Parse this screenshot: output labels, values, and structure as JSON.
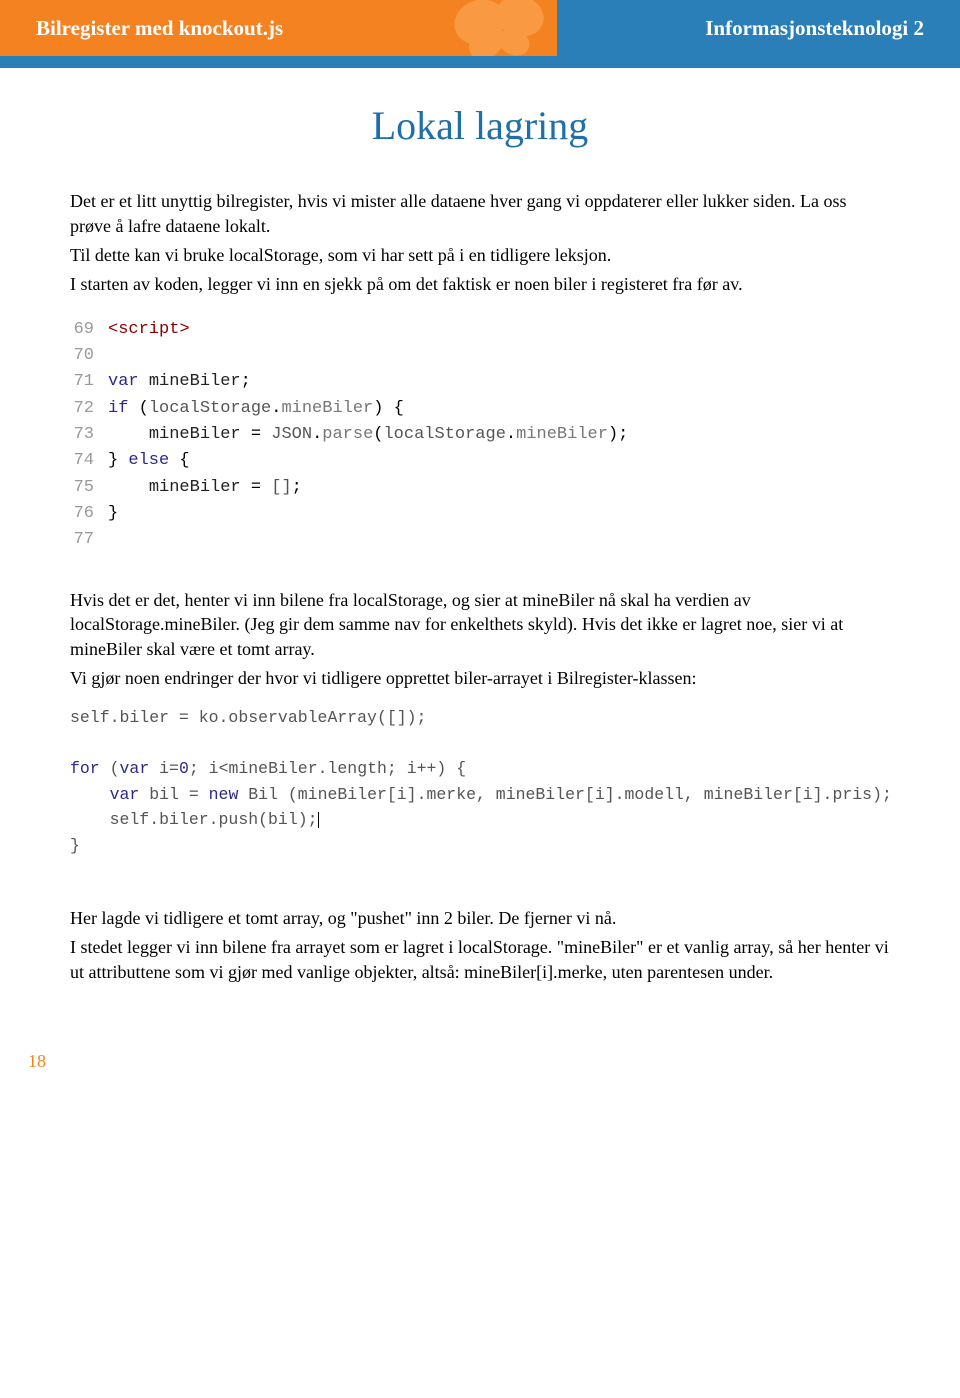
{
  "header": {
    "left": "Bilregister med knockout.js",
    "right": "Informasjonsteknologi 2"
  },
  "title": "Lokal lagring",
  "para1": "Det er et litt unyttig bilregister, hvis vi mister alle dataene hver gang vi oppdaterer eller lukker siden. La oss prøve å lafre dataene lokalt.",
  "para2": "Til dette kan vi bruke localStorage, som vi har sett på i en tidligere leksjon.",
  "para3": "I starten av koden, legger vi inn en sjekk på om det faktisk er noen biler i registeret fra før av.",
  "code1": {
    "lines": [
      {
        "n": "69",
        "html": "<span class='tok-tag'>&lt;script&gt;</span>"
      },
      {
        "n": "70",
        "html": ""
      },
      {
        "n": "71",
        "html": "<span class='tok-kw'>var</span> <span class='tok-var'>mineBiler</span>;"
      },
      {
        "n": "72",
        "html": "<span class='tok-kw'>if</span> (<span class='tok-obj'>localStorage</span>.<span class='tok-prop'>mineBiler</span>) {"
      },
      {
        "n": "73",
        "html": "    <span class='tok-var'>mineBiler</span> = <span class='tok-obj'>JSON</span>.<span class='tok-fn'>parse</span>(<span class='tok-obj'>localStorage</span>.<span class='tok-prop'>mineBiler</span>);"
      },
      {
        "n": "74",
        "html": "} <span class='tok-kw'>else</span> {"
      },
      {
        "n": "75",
        "html": "    <span class='tok-var'>mineBiler</span> = <span class='tok-bracket'>[]</span>;"
      },
      {
        "n": "76",
        "html": "}"
      },
      {
        "n": "77",
        "html": ""
      }
    ]
  },
  "para4": "Hvis det er det, henter vi inn bilene fra localStorage, og sier at mineBiler nå skal ha verdien av localStorage.mineBiler. (Jeg gir dem samme nav for enkelthets skyld). Hvis det ikke er lagret noe, sier vi at mineBiler skal være et tomt array.",
  "para5": "Vi gjør noen endringer der hvor vi tidligere opprettet biler-arrayet i Bilregister-klassen:",
  "code2": {
    "lines": [
      "self.biler = ko.observableArray([]);",
      "",
      "for (var i=0; i<mineBiler.length; i++) {",
      "    var bil = new Bil (mineBiler[i].merke, mineBiler[i].modell, mineBiler[i].pris);",
      "    self.biler.push(bil);|",
      "}"
    ]
  },
  "para6": "Her lagde vi tidligere et tomt array, og \"pushet\" inn 2 biler. De fjerner vi nå.",
  "para7": "I stedet legger vi inn bilene fra arrayet som er lagret i localStorage. \"mineBiler\" er et vanlig array, så her henter vi ut attributtene som vi gjør med vanlige objekter, altså: mineBiler[i].merke, uten parentesen under.",
  "pageNumber": "18"
}
